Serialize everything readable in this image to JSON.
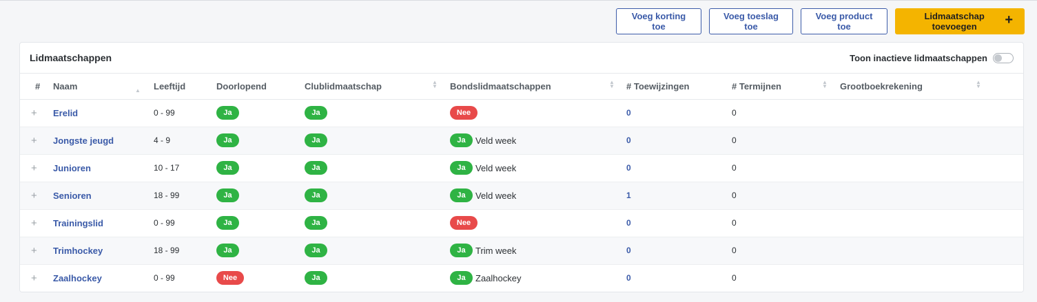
{
  "toolbar": {
    "discount_label": "Voeg korting toe",
    "surcharge_label": "Voeg toeslag toe",
    "product_label": "Voeg product toe",
    "add_membership_label": "Lidmaatschap toevoegen",
    "add_icon": "plus-icon"
  },
  "card": {
    "title": "Lidmaatschappen",
    "toggle_label": "Toon inactieve lidmaatschappen"
  },
  "table": {
    "headers": [
      "#",
      "Naam",
      "Leeftijd",
      "Doorlopend",
      "Clublidmaatschap",
      "Bondslidmaatschappen",
      "# Toewijzingen",
      "# Termijnen",
      "Grootboekrekening"
    ],
    "rows": [
      {
        "expand": "+",
        "name": "Erelid",
        "age": "0 - 99",
        "continuous": "Ja",
        "club": "Ja",
        "bond_badge": "Nee",
        "bond_text": "",
        "assignments": "0",
        "terms": "0",
        "ledger": ""
      },
      {
        "expand": "+",
        "name": "Jongste jeugd",
        "age": "4 - 9",
        "continuous": "Ja",
        "club": "Ja",
        "bond_badge": "Ja",
        "bond_text": "Veld week",
        "assignments": "0",
        "terms": "0",
        "ledger": ""
      },
      {
        "expand": "+",
        "name": "Junioren",
        "age": "10 - 17",
        "continuous": "Ja",
        "club": "Ja",
        "bond_badge": "Ja",
        "bond_text": "Veld week",
        "assignments": "0",
        "terms": "0",
        "ledger": ""
      },
      {
        "expand": "+",
        "name": "Senioren",
        "age": "18 - 99",
        "continuous": "Ja",
        "club": "Ja",
        "bond_badge": "Ja",
        "bond_text": "Veld week",
        "assignments": "1",
        "terms": "0",
        "ledger": ""
      },
      {
        "expand": "+",
        "name": "Trainingslid",
        "age": "0 - 99",
        "continuous": "Ja",
        "club": "Ja",
        "bond_badge": "Nee",
        "bond_text": "",
        "assignments": "0",
        "terms": "0",
        "ledger": ""
      },
      {
        "expand": "+",
        "name": "Trimhockey",
        "age": "18 - 99",
        "continuous": "Ja",
        "club": "Ja",
        "bond_badge": "Ja",
        "bond_text": "Trim week",
        "assignments": "0",
        "terms": "0",
        "ledger": ""
      },
      {
        "expand": "+",
        "name": "Zaalhockey",
        "age": "0 - 99",
        "continuous": "Nee",
        "club": "Ja",
        "bond_badge": "Ja",
        "bond_text": "Zaalhockey",
        "assignments": "0",
        "terms": "0",
        "ledger": ""
      }
    ]
  },
  "colors": {
    "accent": "#3a5aa8",
    "primary_button": "#f4b400",
    "badge_yes": "#2fb344",
    "badge_no": "#e84a4a"
  }
}
